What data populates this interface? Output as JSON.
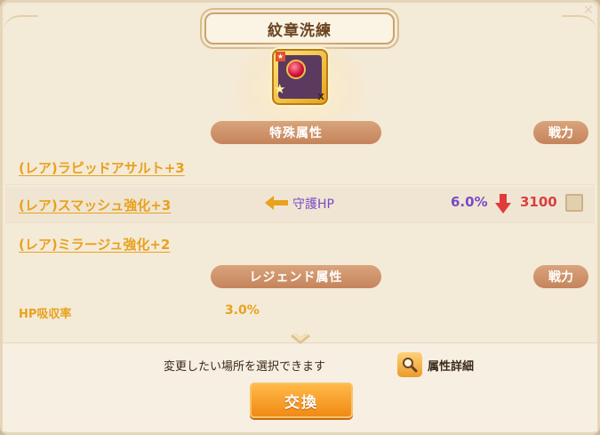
{
  "title": "紋章洗練",
  "close_icon": "×",
  "special": {
    "header": "特殊属性",
    "power_label": "戦力",
    "attributes": [
      "(レア)ラピッドアサルト+3",
      "(レア)スマッシュ強化+3",
      "(レア)ミラージュ強化+2"
    ],
    "comparison": {
      "stat": "守護HP",
      "percent": "6.0%",
      "power": "3100",
      "trend": "down"
    }
  },
  "legend": {
    "header": "レジェンド属性",
    "power_label": "戦力",
    "name": "HP吸収率",
    "value": "3.0%"
  },
  "footer": {
    "instruction": "変更したい場所を選択できます",
    "detail_label": "属性詳細",
    "exchange_label": "交換"
  },
  "colors": {
    "accent_orange": "#e8a21e",
    "header_brown": "#c5845b",
    "purple": "#7a4ac8",
    "red": "#d84040"
  },
  "icons": {
    "close": "close-icon",
    "emblem": "emblem-icon",
    "arrow": "arrow-left-icon",
    "down": "arrow-down-icon",
    "search": "search-icon",
    "chevron": "chevron-down-icon"
  }
}
